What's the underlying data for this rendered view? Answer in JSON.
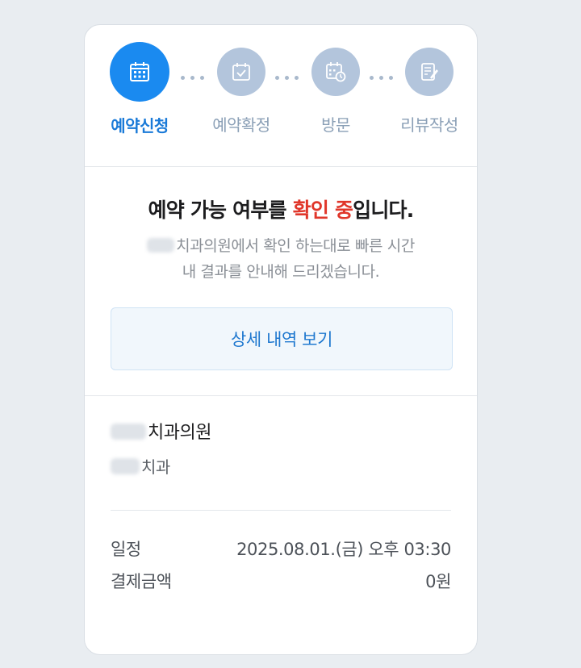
{
  "steps": [
    {
      "label": "예약신청",
      "icon": "calendar-grid-icon",
      "active": true
    },
    {
      "label": "예약확정",
      "icon": "calendar-check-icon",
      "active": false
    },
    {
      "label": "방문",
      "icon": "calendar-clock-icon",
      "active": false
    },
    {
      "label": "리뷰작성",
      "icon": "review-edit-icon",
      "active": false
    }
  ],
  "status": {
    "title_prefix": "예약 가능 여부를 ",
    "title_highlight": "확인 중",
    "title_suffix": "입니다.",
    "desc_line1": "치과의원에서 확인 하는대로 빠른 시간",
    "desc_line2": "내 결과를 안내해 드리겠습니다.",
    "detail_button": "상세 내역 보기"
  },
  "clinic": {
    "name": "치과의원",
    "type": "치과"
  },
  "schedule": {
    "label": "일정",
    "value": "2025.08.01.(금) 오후 03:30"
  },
  "payment": {
    "label": "결제금액",
    "value": "0원"
  },
  "colors": {
    "accent": "#1a8af0",
    "inactive_step": "#b3c5dc",
    "highlight": "#e0362a"
  }
}
